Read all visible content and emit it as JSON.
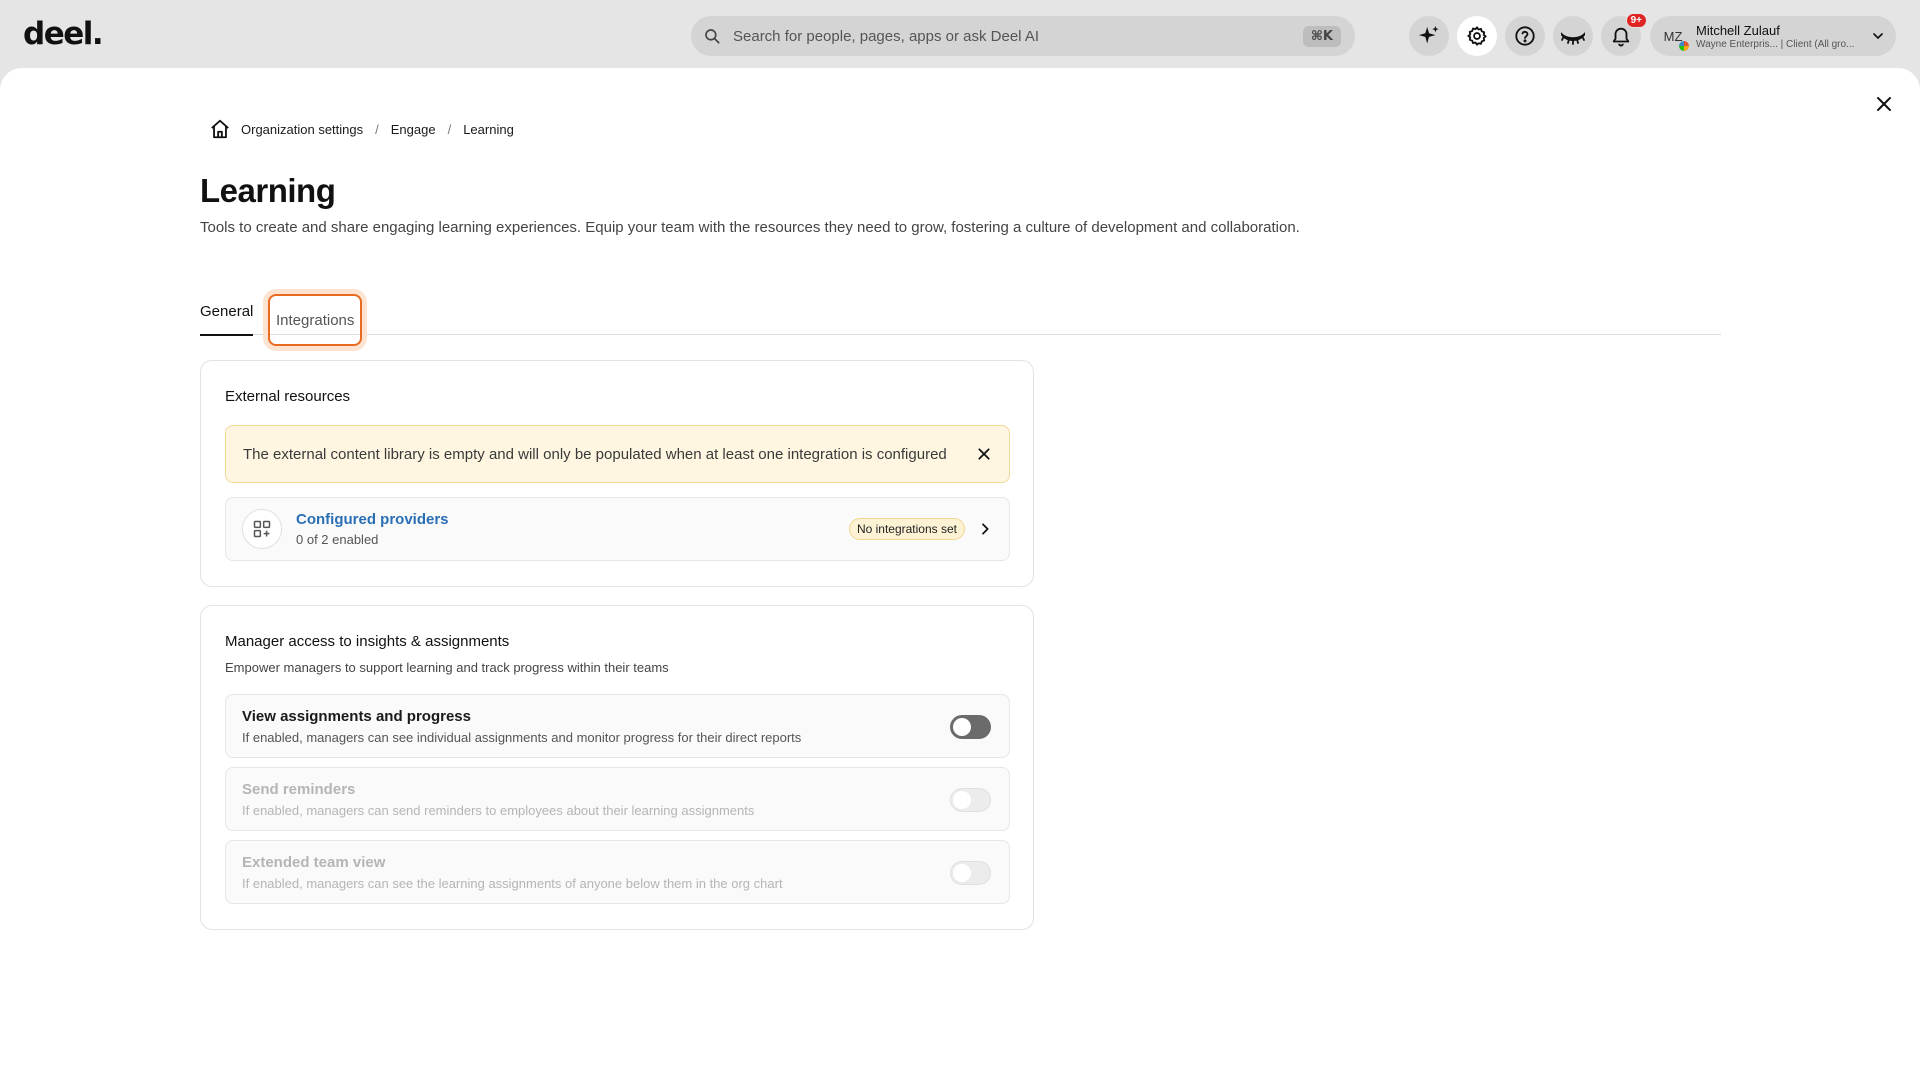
{
  "topbar": {
    "logo": "deel.",
    "search_placeholder": "Search for people, pages, apps or ask Deel AI",
    "search_shortcut": "⌘K",
    "notification_count": "9+",
    "user": {
      "initials": "MZ",
      "name": "Mitchell Zulauf",
      "subtitle": "Wayne Enterpris... | Client (All gro..."
    }
  },
  "breadcrumb": {
    "items": [
      "Organization settings",
      "Engage",
      "Learning"
    ],
    "separator": "/"
  },
  "page": {
    "title": "Learning",
    "description": "Tools to create and share engaging learning experiences. Equip your team with the resources they need to grow, fostering a culture of development and collaboration."
  },
  "tabs": [
    {
      "label": "General",
      "active": true
    },
    {
      "label": "Integrations",
      "active": false
    }
  ],
  "external_resources": {
    "title": "External resources",
    "alert": "The external content library is empty and will only be populated when at least one integration is configured",
    "provider": {
      "title": "Configured providers",
      "subtitle": "0 of 2 enabled",
      "badge": "No integrations set"
    }
  },
  "manager_access": {
    "title": "Manager access to insights & assignments",
    "description": "Empower managers to support learning and track progress within their teams",
    "settings": [
      {
        "title": "View assignments and progress",
        "subtitle": "If enabled, managers can see individual assignments and monitor progress for their direct reports",
        "enabled": false,
        "disabled": false
      },
      {
        "title": "Send reminders",
        "subtitle": "If enabled, managers can send reminders to employees about their learning assignments",
        "enabled": false,
        "disabled": true
      },
      {
        "title": "Extended team view",
        "subtitle": "If enabled, managers can see the learning assignments of anyone below them in the org chart",
        "enabled": false,
        "disabled": true
      }
    ]
  },
  "colors": {
    "accent_focus": "#ea6a1e",
    "link": "#2a6fb5",
    "alert_bg": "#fef6e1",
    "notification": "#e02424"
  }
}
